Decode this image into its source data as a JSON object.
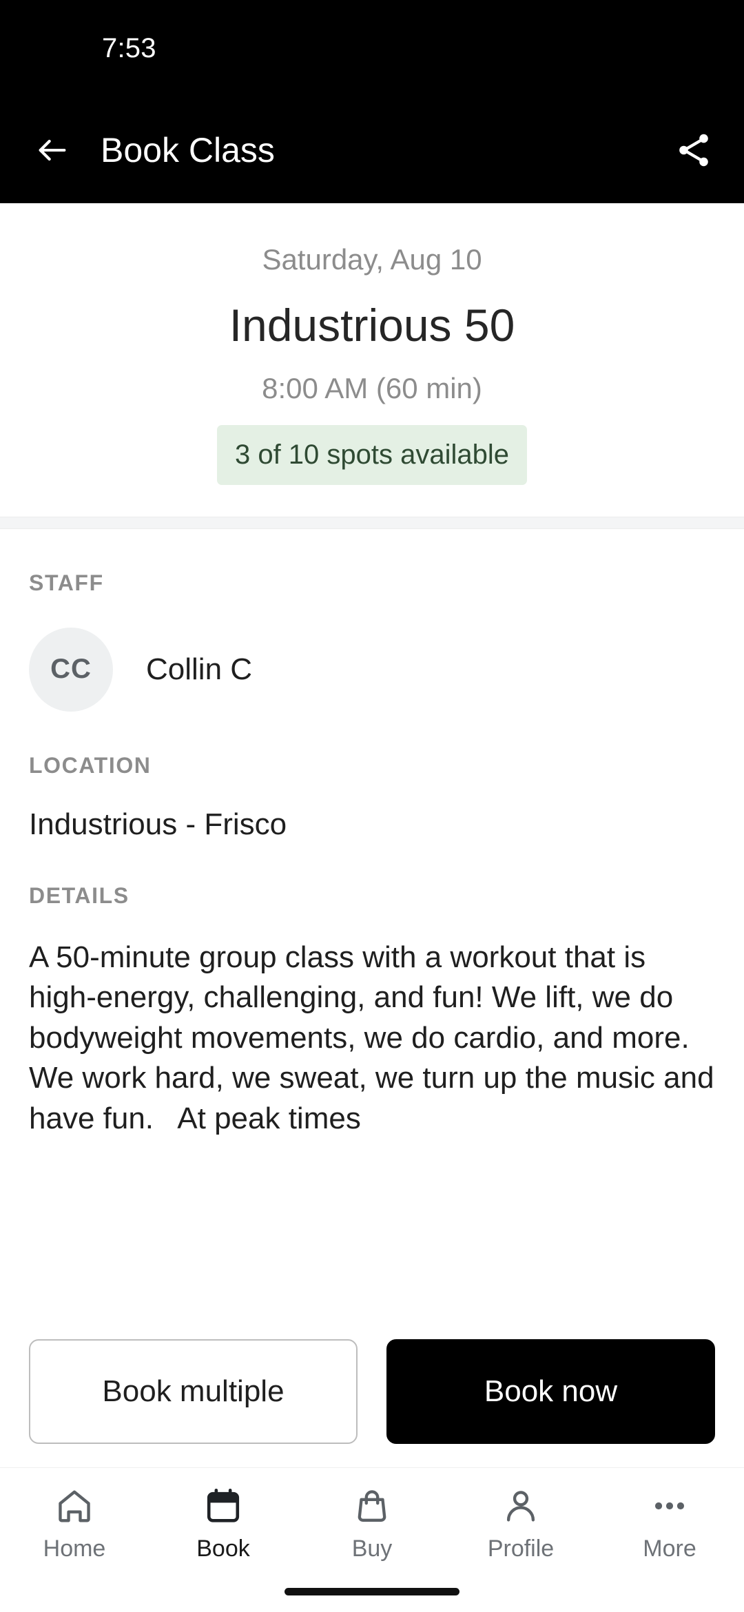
{
  "status_bar": {
    "time": "7:53"
  },
  "app_bar": {
    "title": "Book Class",
    "back_icon": "arrow-left-icon",
    "share_icon": "share-icon"
  },
  "class_header": {
    "date": "Saturday, Aug 10",
    "name": "Industrious 50",
    "time": "8:00 AM (60 min)",
    "spots": "3 of 10 spots available",
    "spots_bg": "#e4f0e4",
    "spots_color": "#2f4a33"
  },
  "sections": {
    "staff": {
      "label": "STAFF",
      "avatar_initials": "CC",
      "name": "Collin C"
    },
    "location": {
      "label": "LOCATION",
      "value": "Industrious - Frisco"
    },
    "details": {
      "label": "DETAILS",
      "body": "A 50-minute group class with a workout that is high-energy, challenging, and fun! We lift, we do bodyweight movements, we do cardio, and more.   We work hard, we sweat, we turn up the music and have fun.   At peak times"
    }
  },
  "actions": {
    "secondary_label": "Book multiple",
    "primary_label": "Book now"
  },
  "bottom_nav": {
    "items": [
      {
        "label": "Home",
        "icon": "home-icon",
        "active": false
      },
      {
        "label": "Book",
        "icon": "calendar-icon",
        "active": true
      },
      {
        "label": "Buy",
        "icon": "shopping-bag-icon",
        "active": false
      },
      {
        "label": "Profile",
        "icon": "person-icon",
        "active": false
      },
      {
        "label": "More",
        "icon": "more-dots-icon",
        "active": false
      }
    ]
  }
}
